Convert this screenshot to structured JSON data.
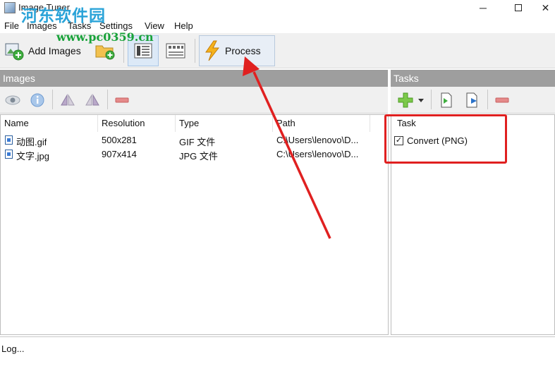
{
  "window": {
    "title": "Image Tuner",
    "minimize_glyph": "─",
    "close_glyph": "✕"
  },
  "watermark": {
    "cn_text": "河东软件园",
    "url_text": "www.pc0359.cn"
  },
  "menubar": {
    "items": [
      {
        "label": "File"
      },
      {
        "label": "Images"
      },
      {
        "label": "Tasks"
      },
      {
        "label": "Settings"
      },
      {
        "label": "View"
      },
      {
        "label": "Help"
      }
    ]
  },
  "toolbar": {
    "add_images_label": "Add Images",
    "process_label": "Process"
  },
  "images_panel": {
    "header": "Images",
    "columns": [
      "Name",
      "Resolution",
      "Type",
      "Path"
    ],
    "rows": [
      {
        "name": "动图.gif",
        "resolution": "500x281",
        "type": "GIF 文件",
        "path": "C:\\Users\\lenovo\\D..."
      },
      {
        "name": "文字.jpg",
        "resolution": "907x414",
        "type": "JPG 文件",
        "path": "C:\\Users\\lenovo\\D..."
      }
    ]
  },
  "tasks_panel": {
    "header": "Tasks",
    "column": "Task",
    "items": [
      {
        "label": "Convert (PNG)",
        "checked": true
      }
    ]
  },
  "log": {
    "text": "Log..."
  },
  "colors": {
    "annotation_red": "#e02020",
    "panel_header": "#9e9e9e",
    "watermark_blue": "#2aa3d8",
    "watermark_green": "#19a23a"
  }
}
